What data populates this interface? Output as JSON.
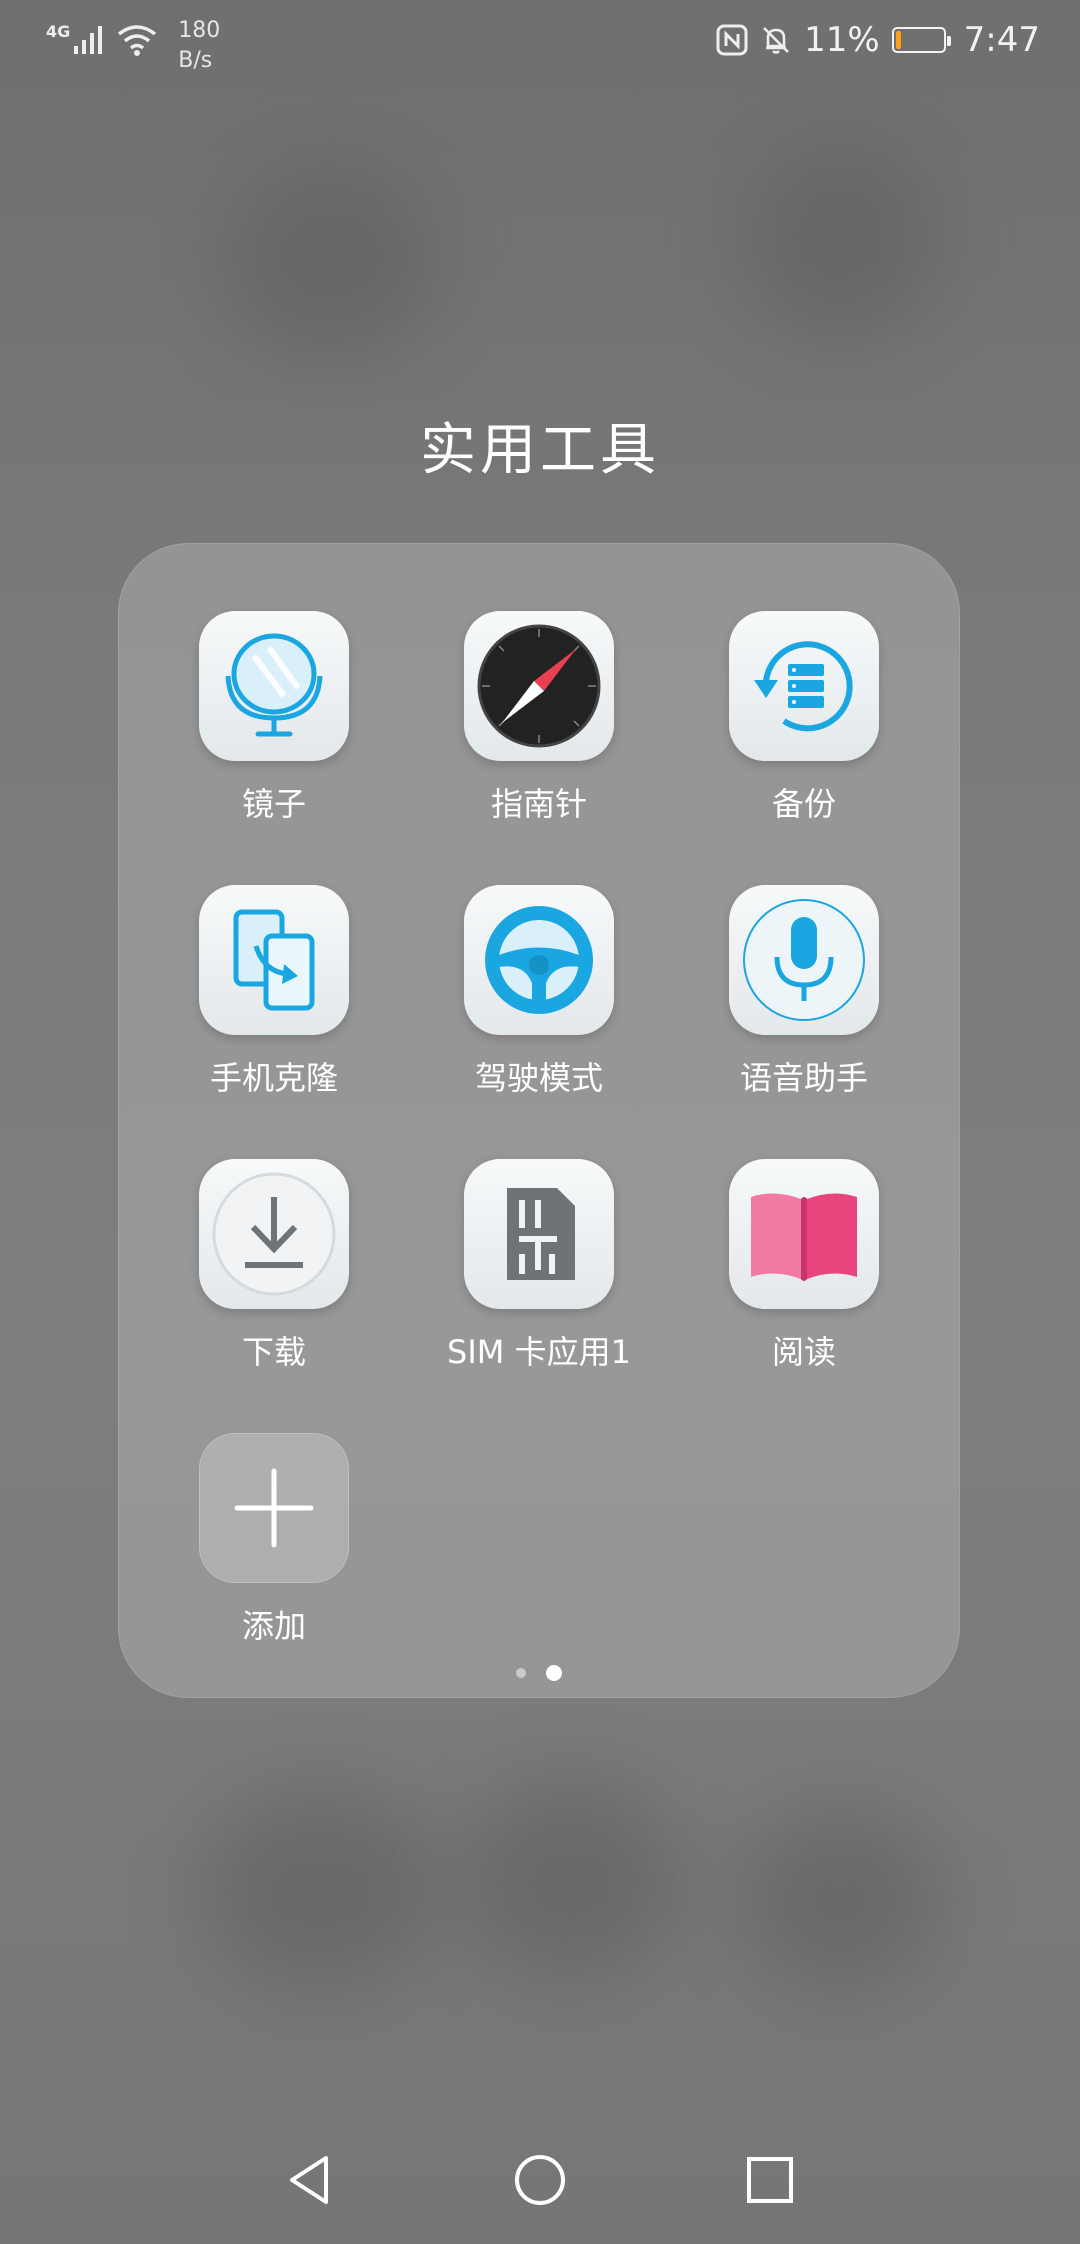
{
  "status_bar": {
    "network_type": "4G",
    "net_speed_value": "180",
    "net_speed_unit": "B/s",
    "battery_percent": "11%",
    "battery_level": 0.11,
    "time": "7:47",
    "battery_color": "#ff9f1a"
  },
  "folder": {
    "title": "实用工具",
    "apps": [
      {
        "label": "镜子",
        "icon": "mirror-icon"
      },
      {
        "label": "指南针",
        "icon": "compass-icon"
      },
      {
        "label": "备份",
        "icon": "backup-icon"
      },
      {
        "label": "手机克隆",
        "icon": "phone-clone-icon"
      },
      {
        "label": "驾驶模式",
        "icon": "steering-wheel-icon"
      },
      {
        "label": "语音助手",
        "icon": "microphone-icon"
      },
      {
        "label": "下载",
        "icon": "download-icon"
      },
      {
        "label": "SIM 卡应用1",
        "icon": "sim-card-icon"
      },
      {
        "label": "阅读",
        "icon": "book-icon"
      },
      {
        "label": "添加",
        "icon": "plus-icon"
      }
    ],
    "page_count": 2,
    "active_page": 2
  },
  "nav_bar": {
    "back": "back-icon",
    "home": "home-icon",
    "recents": "recents-icon"
  },
  "colors": {
    "accent_blue": "#1aa6e0",
    "book_pink": "#e8457e"
  }
}
